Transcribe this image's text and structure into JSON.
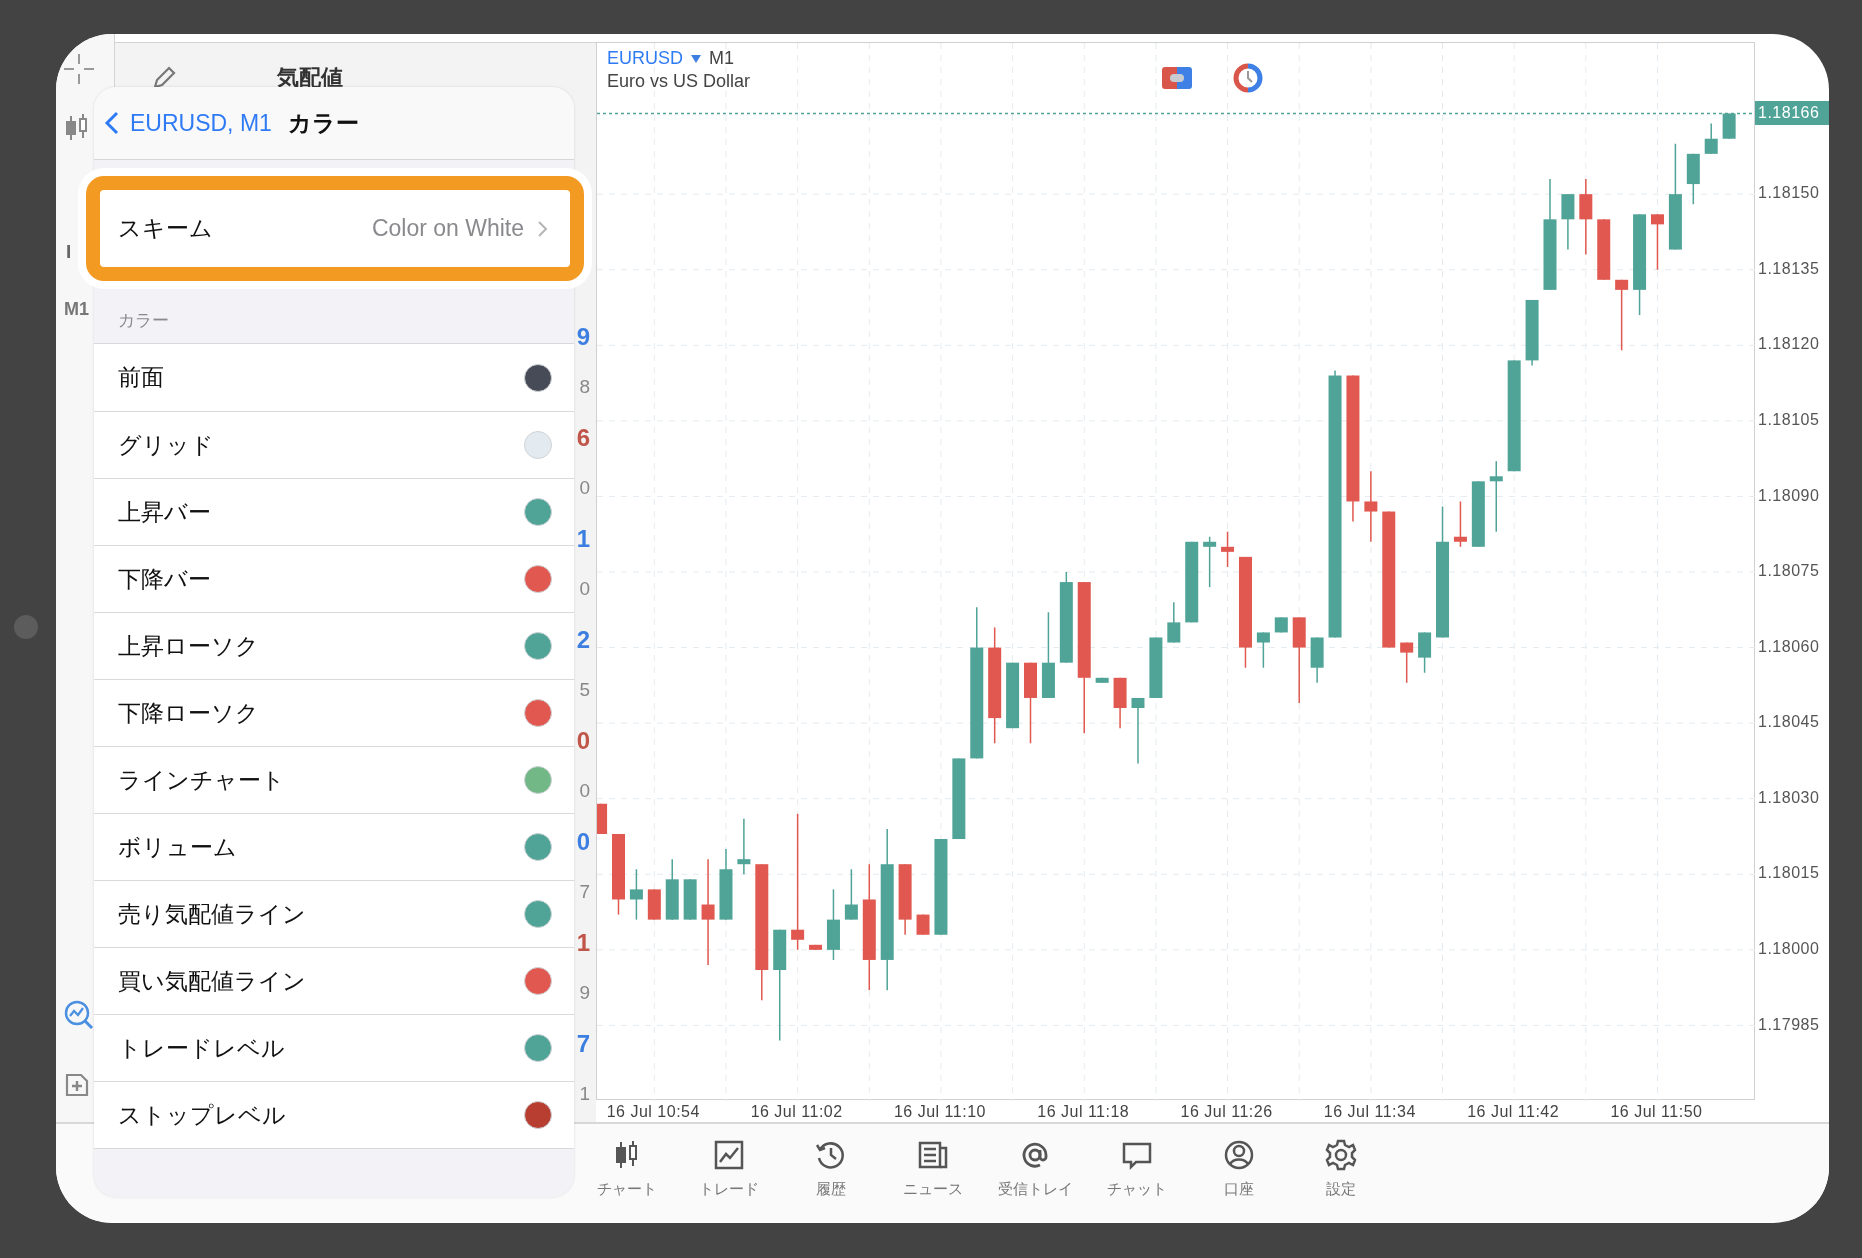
{
  "toolbar": {
    "partial_label": "I",
    "timeframe": "M1"
  },
  "quotes_panel": {
    "title": "気配値",
    "rows": [
      {
        "digit": "9",
        "color": "#3d7fe0",
        "subdigit": "8"
      },
      {
        "digit": "6",
        "color": "#c0564a",
        "subdigit": "0"
      },
      {
        "digit": "1",
        "color": "#3d7fe0",
        "subdigit": "0"
      },
      {
        "digit": "2",
        "color": "#3d7fe0",
        "subdigit": "5"
      },
      {
        "digit": "0",
        "color": "#c0564a",
        "subdigit": "0"
      },
      {
        "digit": "0",
        "color": "#3d7fe0",
        "subdigit": "7"
      },
      {
        "digit": "1",
        "color": "#c0564a",
        "subdigit": "9"
      },
      {
        "digit": "7",
        "color": "#3d7fe0",
        "subdigit": "1"
      }
    ]
  },
  "popover": {
    "back_label": "EURUSD, M1",
    "title": "カラー",
    "scheme": {
      "label": "スキーム",
      "value": "Color on White",
      "highlighted": true
    },
    "section_title": "カラー",
    "colors": [
      {
        "label": "前面",
        "color": "#474a57"
      },
      {
        "label": "グリッド",
        "color": "#e4ebf0"
      },
      {
        "label": "上昇バー",
        "color": "#4fa397"
      },
      {
        "label": "下降バー",
        "color": "#e0584f"
      },
      {
        "label": "上昇ローソク",
        "color": "#4fa397"
      },
      {
        "label": "下降ローソク",
        "color": "#e0584f"
      },
      {
        "label": "ラインチャート",
        "color": "#72b887"
      },
      {
        "label": "ボリューム",
        "color": "#4fa397"
      },
      {
        "label": "売り気配値ライン",
        "color": "#4fa397"
      },
      {
        "label": "買い気配値ライン",
        "color": "#e0584f"
      },
      {
        "label": "トレードレベル",
        "color": "#4fa397"
      },
      {
        "label": "ストップレベル",
        "color": "#b83e32"
      }
    ]
  },
  "chart": {
    "symbol": "EURUSD",
    "timeframe": "M1",
    "description": "Euro vs US Dollar",
    "chart_data": {
      "type": "candlestick",
      "categories": [
        null,
        null,
        null,
        "16 Jul 10:54",
        null,
        null,
        null,
        null,
        null,
        null,
        null,
        "16 Jul 11:02",
        null,
        null,
        null,
        null,
        null,
        null,
        null,
        "16 Jul 11:10",
        null,
        null,
        null,
        null,
        null,
        null,
        null,
        "16 Jul 11:18",
        null,
        null,
        null,
        null,
        null,
        null,
        null,
        "16 Jul 11:26",
        null,
        null,
        null,
        null,
        null,
        null,
        null,
        "16 Jul 11:34",
        null,
        null,
        null,
        null,
        null,
        null,
        null,
        "16 Jul 11:42",
        null,
        null,
        null,
        null,
        null,
        null,
        null,
        "16 Jul 11:50",
        null,
        null,
        null,
        null
      ],
      "ohlc": [
        [
          1.18029,
          1.18029,
          1.18023,
          1.18023
        ],
        [
          1.18023,
          1.18023,
          1.18007,
          1.1801
        ],
        [
          1.1801,
          1.18016,
          1.18006,
          1.18012
        ],
        [
          1.18012,
          1.18012,
          1.18006,
          1.18006
        ],
        [
          1.18006,
          1.18018,
          1.18006,
          1.18014
        ],
        [
          1.18006,
          1.18014,
          1.18006,
          1.18014
        ],
        [
          1.18009,
          1.18018,
          1.17997,
          1.18006
        ],
        [
          1.18006,
          1.1802,
          1.18006,
          1.18016
        ],
        [
          1.18017,
          1.18026,
          1.18015,
          1.18018
        ],
        [
          1.18017,
          1.18017,
          1.1799,
          1.17996
        ],
        [
          1.17996,
          1.18004,
          1.17982,
          1.18004
        ],
        [
          1.18004,
          1.18027,
          1.18,
          1.18002
        ],
        [
          1.18001,
          1.18001,
          1.18,
          1.18
        ],
        [
          1.18,
          1.18012,
          1.17998,
          1.18006
        ],
        [
          1.18006,
          1.18016,
          1.18006,
          1.18009
        ],
        [
          1.1801,
          1.18017,
          1.17992,
          1.17998
        ],
        [
          1.17998,
          1.18024,
          1.17992,
          1.18017
        ],
        [
          1.18017,
          1.18017,
          1.18003,
          1.18006
        ],
        [
          1.18007,
          1.18007,
          1.18003,
          1.18003
        ],
        [
          1.18003,
          1.18022,
          1.18003,
          1.18022
        ],
        [
          1.18022,
          1.18038,
          1.18022,
          1.18038
        ],
        [
          1.18038,
          1.18068,
          1.18038,
          1.1806
        ],
        [
          1.1806,
          1.18064,
          1.18041,
          1.18046
        ],
        [
          1.18044,
          1.18057,
          1.18044,
          1.18057
        ],
        [
          1.18057,
          1.18057,
          1.18041,
          1.1805
        ],
        [
          1.1805,
          1.18067,
          1.1805,
          1.18057
        ],
        [
          1.18057,
          1.18075,
          1.18057,
          1.18073
        ],
        [
          1.18073,
          1.18073,
          1.18043,
          1.18054
        ],
        [
          1.18053,
          1.18054,
          1.18053,
          1.18054
        ],
        [
          1.18054,
          1.18054,
          1.18044,
          1.18048
        ],
        [
          1.18048,
          1.1805,
          1.18037,
          1.1805
        ],
        [
          1.1805,
          1.18062,
          1.1805,
          1.18062
        ],
        [
          1.18061,
          1.18069,
          1.18061,
          1.18065
        ],
        [
          1.18065,
          1.18081,
          1.18065,
          1.18081
        ],
        [
          1.1808,
          1.18082,
          1.18072,
          1.18081
        ],
        [
          1.1808,
          1.18083,
          1.18076,
          1.18079
        ],
        [
          1.18078,
          1.18078,
          1.18056,
          1.1806
        ],
        [
          1.18061,
          1.18063,
          1.18056,
          1.18063
        ],
        [
          1.18063,
          1.18066,
          1.18063,
          1.18066
        ],
        [
          1.18066,
          1.18066,
          1.18049,
          1.1806
        ],
        [
          1.18056,
          1.18062,
          1.18053,
          1.18062
        ],
        [
          1.18062,
          1.18115,
          1.18062,
          1.18114
        ],
        [
          1.18114,
          1.18114,
          1.18085,
          1.18089
        ],
        [
          1.18089,
          1.18095,
          1.18081,
          1.18087
        ],
        [
          1.18087,
          1.18087,
          1.1806,
          1.1806
        ],
        [
          1.18061,
          1.18061,
          1.18053,
          1.18059
        ],
        [
          1.18058,
          1.18063,
          1.18055,
          1.18063
        ],
        [
          1.18062,
          1.18088,
          1.18062,
          1.18081
        ],
        [
          1.18082,
          1.18089,
          1.1808,
          1.18081
        ],
        [
          1.1808,
          1.18093,
          1.1808,
          1.18093
        ],
        [
          1.18093,
          1.18097,
          1.18083,
          1.18094
        ],
        [
          1.18095,
          1.18117,
          1.18095,
          1.18117
        ],
        [
          1.18117,
          1.18129,
          1.18116,
          1.18129
        ],
        [
          1.18131,
          1.18153,
          1.18131,
          1.18145
        ],
        [
          1.18145,
          1.1815,
          1.18139,
          1.1815
        ],
        [
          1.1815,
          1.18153,
          1.18138,
          1.18145
        ],
        [
          1.18145,
          1.18145,
          1.18133,
          1.18133
        ],
        [
          1.18133,
          1.18133,
          1.18119,
          1.18131
        ],
        [
          1.18131,
          1.18146,
          1.18126,
          1.18146
        ],
        [
          1.18146,
          1.18146,
          1.18135,
          1.18144
        ],
        [
          1.18139,
          1.1816,
          1.18139,
          1.1815
        ],
        [
          1.18152,
          1.18158,
          1.18148,
          1.18158
        ],
        [
          1.18158,
          1.18164,
          1.18158,
          1.18161
        ],
        [
          1.18161,
          1.18166,
          1.18161,
          1.18166
        ]
      ],
      "ylim": [
        1.1797,
        1.1818
      ],
      "grid": true,
      "ref_lines": [
        {
          "axis": "y",
          "value": 1.18166,
          "label": "1.18166",
          "color": "#4fa397"
        }
      ],
      "yticks": [
        {
          "value": 1.1815,
          "label": "1.18150"
        },
        {
          "value": 1.18135,
          "label": "1.18135"
        },
        {
          "value": 1.1812,
          "label": "1.18120"
        },
        {
          "value": 1.18105,
          "label": "1.18105"
        },
        {
          "value": 1.1809,
          "label": "1.18090"
        },
        {
          "value": 1.18075,
          "label": "1.18075"
        },
        {
          "value": 1.1806,
          "label": "1.18060"
        },
        {
          "value": 1.18045,
          "label": "1.18045"
        },
        {
          "value": 1.1803,
          "label": "1.18030"
        },
        {
          "value": 1.18015,
          "label": "1.18015"
        },
        {
          "value": 1.18,
          "label": "1.18000"
        },
        {
          "value": 1.17985,
          "label": "1.17985"
        }
      ]
    }
  },
  "tab_bar": [
    {
      "label": "チャート",
      "kind": "chart"
    },
    {
      "label": "トレード",
      "kind": "trade"
    },
    {
      "label": "履歴",
      "kind": "history"
    },
    {
      "label": "ニュース",
      "kind": "news"
    },
    {
      "label": "受信トレイ",
      "kind": "mail"
    },
    {
      "label": "チャット",
      "kind": "chat"
    },
    {
      "label": "口座",
      "kind": "account"
    },
    {
      "label": "設定",
      "kind": "settings"
    }
  ]
}
